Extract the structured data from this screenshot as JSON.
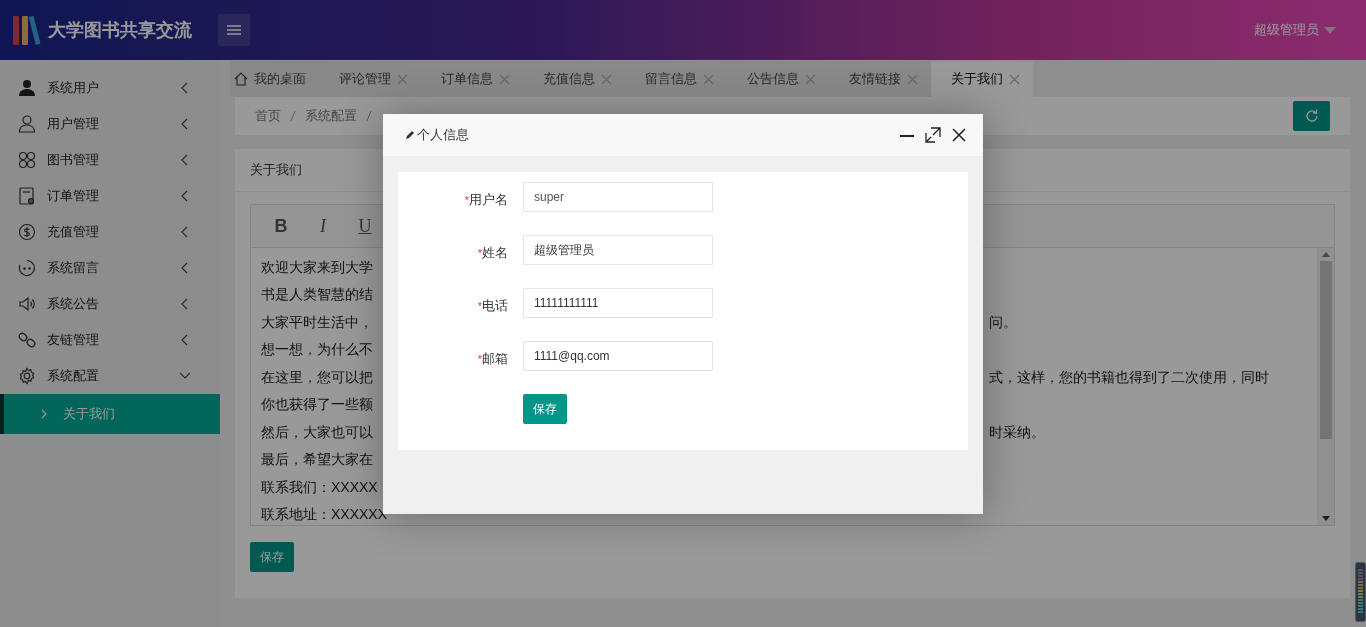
{
  "header": {
    "title": "大学图书共享交流",
    "user": "超级管理员"
  },
  "sidebar": {
    "items": [
      {
        "label": "系统用户",
        "expanded": false
      },
      {
        "label": "用户管理",
        "expanded": false
      },
      {
        "label": "图书管理",
        "expanded": false
      },
      {
        "label": "订单管理",
        "expanded": false
      },
      {
        "label": "充值管理",
        "expanded": false
      },
      {
        "label": "系统留言",
        "expanded": false
      },
      {
        "label": "系统公告",
        "expanded": false
      },
      {
        "label": "友链管理",
        "expanded": false
      },
      {
        "label": "系统配置",
        "expanded": true,
        "children": [
          {
            "label": "关于我们",
            "selected": true
          }
        ]
      }
    ]
  },
  "tabs": [
    {
      "label": "我的桌面",
      "kind": "home",
      "selected": false
    },
    {
      "label": "评论管理",
      "kind": "closable",
      "selected": false
    },
    {
      "label": "订单信息",
      "kind": "closable",
      "selected": false
    },
    {
      "label": "充值信息",
      "kind": "closable",
      "selected": false
    },
    {
      "label": "留言信息",
      "kind": "closable",
      "selected": false
    },
    {
      "label": "公告信息",
      "kind": "closable",
      "selected": false
    },
    {
      "label": "友情链接",
      "kind": "closable",
      "selected": false
    },
    {
      "label": "关于我们",
      "kind": "closable",
      "selected": true
    }
  ],
  "breadcrumb": [
    "首页",
    "系统配置"
  ],
  "card": {
    "title": "关于我们",
    "toolbar": [
      "B",
      "I",
      "U"
    ],
    "lines": [
      {
        "start": "欢迎大家来到大学"
      },
      {
        "start": "书是人类智慧的结"
      },
      {
        "start": "大家平时生活中，",
        "end": "问。"
      },
      {
        "start": "想一想，为什么不"
      },
      {
        "start": "在这里，您可以把",
        "end": "式，这样，您的书籍也得到了二次使用，同时"
      },
      {
        "start": "你也获得了一些额"
      },
      {
        "start": "然后，大家也可以",
        "end": "时采纳。"
      },
      {
        "start": "最后，希望大家在"
      },
      {
        "start": "联系我们：XXXXX"
      },
      {
        "start": "联系地址：XXXXXX"
      }
    ],
    "save": "保存"
  },
  "dialog": {
    "title": "个人信息",
    "fields": [
      {
        "label": "用户名",
        "required_mark": "*",
        "value": "super",
        "disabled": true
      },
      {
        "label": "姓名",
        "required_mark": "*",
        "value": "超级管理员",
        "disabled": false
      },
      {
        "label": "电话",
        "required_mark": "*",
        "value": "11111111111",
        "disabled": false
      },
      {
        "label": "邮箱",
        "required_mark": "*",
        "value": "1111@qq.com",
        "disabled": false
      }
    ],
    "save": "保存"
  }
}
